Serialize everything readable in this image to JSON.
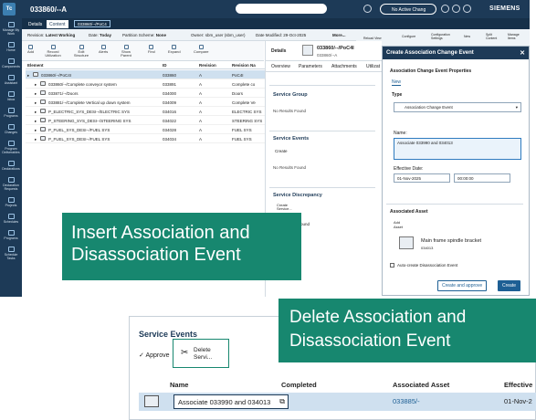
{
  "topbar": {
    "app_badge": "Tc",
    "object_title": "033860/--A",
    "search_placeholder": "",
    "change_context": "No Active Chang",
    "brand": "SIEMENS"
  },
  "sidebar": {
    "items": [
      {
        "label": "Manage My Work",
        "icon": "inbox-icon"
      },
      {
        "label": "Home",
        "icon": "home-icon"
      },
      {
        "label": "Components",
        "icon": "components-icon"
      },
      {
        "label": "Assistant",
        "icon": "assistant-icon"
      },
      {
        "label": "Inbox",
        "icon": "inbox-tray-icon"
      },
      {
        "label": "Programs",
        "icon": "programs-icon"
      },
      {
        "label": "Changes",
        "icon": "changes-icon"
      },
      {
        "label": "Program Deliverables",
        "icon": "deliverables-icon"
      },
      {
        "label": "Declarations",
        "icon": "declarations-icon"
      },
      {
        "label": "Declaration Requests",
        "icon": "requests-icon"
      },
      {
        "label": "Projects",
        "icon": "projects-icon"
      },
      {
        "label": "Schedules",
        "icon": "schedules-icon"
      },
      {
        "label": "Programs",
        "icon": "programs2-icon"
      },
      {
        "label": "Schedule Tasks",
        "icon": "tasks-icon"
      }
    ]
  },
  "tabs": {
    "details": "Details",
    "content": "Content",
    "crumb": "033860/--/PoC4"
  },
  "toolbar1": {
    "revision_rule_label": "Revision:",
    "revision_rule_value": "Latest Working",
    "date_label": "Date:",
    "date_value": "Today",
    "partition_label": "Partition Scheme:",
    "partition_value": "None",
    "owner_label": "Owner:",
    "owner_value": "sbm_user (sbm_user)",
    "date_modified_label": "Date Modified:",
    "date_modified_value": "29-Oct-2025",
    "more": "More..."
  },
  "toolbar1_right": {
    "items": [
      "Reload View",
      "Configure",
      "Configuration Settings",
      "New",
      "Split Content",
      "Manage Items"
    ]
  },
  "toolbar2": {
    "items": [
      "Add",
      "Record Utilization",
      "Edit Structure",
      "Alerts",
      "Show Parent",
      "Find",
      "Expand",
      "Compare"
    ]
  },
  "grid": {
    "headers": [
      "Element",
      "ID",
      "Revision",
      "Revision Na"
    ],
    "rows": [
      {
        "element": "033860/--/PoC4I",
        "id": "033860",
        "rev": "A",
        "revname": "PoC4I",
        "selected": true,
        "indent": 0
      },
      {
        "element": "033860/--/Complete conveyor system",
        "id": "033891",
        "rev": "A",
        "revname": "Complete co",
        "selected": false,
        "indent": 1
      },
      {
        "element": "033871/--/Doors",
        "id": "034000",
        "rev": "A",
        "revname": "Doors",
        "selected": false,
        "indent": 1
      },
      {
        "element": "033881/--/Complete Vertical up down system",
        "id": "034009",
        "rev": "A",
        "revname": "Complete Ve",
        "selected": false,
        "indent": 1
      },
      {
        "element": "P_ELECTRIC_SYS_DESI--/ELECTRIC SYS",
        "id": "034016",
        "rev": "A",
        "revname": "ELECTRIC SYS",
        "selected": false,
        "indent": 1
      },
      {
        "element": "P_STEERING_SYS_DESI--/STEERING SYS",
        "id": "034022",
        "rev": "A",
        "revname": "STEERING SYS",
        "selected": false,
        "indent": 1
      },
      {
        "element": "P_FUEL_SYS_DESI--/FUEL SYS",
        "id": "034028",
        "rev": "A",
        "revname": "FUEL SYS",
        "selected": false,
        "indent": 1
      },
      {
        "element": "P_FUEL_SYS_DESI--/FUEL SYS",
        "id": "034034",
        "rev": "A",
        "revname": "FUEL SYS",
        "selected": false,
        "indent": 1
      }
    ]
  },
  "mid": {
    "details_label": "Details",
    "title": "033860/--/PoC4I",
    "subtitle": "033860/--A",
    "tabs": [
      "Overview",
      "Parameters",
      "Attachments",
      "Utilizat"
    ],
    "service_group": "Service Group",
    "no_results_1": "No Results Found",
    "service_events": "Service Events",
    "create_label": "Create",
    "no_results_2": "No Results Found",
    "service_discrepancy": "Service Discrepancy",
    "create_service": "Create Service...",
    "partial_text": "ound"
  },
  "dialog": {
    "title": "Create Association Change Event",
    "props_section": "Association Change Event Properties",
    "new_tab": "New",
    "type_section": "Type",
    "type_value": "Association Change Event",
    "name_label": "Name:",
    "name_value": "Associate 033990 and 034013",
    "eff_date_label": "Effective Date:",
    "eff_date_value": "01-Nov-2025",
    "eff_time_value": "00:00:00",
    "asset_section": "Associated Asset",
    "add_label": "Add",
    "asset_label": "Asset",
    "asset_name": "Main frame spindle bracket",
    "asset_id": "034013",
    "auto_create_label": "Auto-create Disassociation Event",
    "btn_create_approve": "Create and approve",
    "btn_create": "Create"
  },
  "overlay1": {
    "line1": "Insert Association and",
    "line2": "Disassociation Event"
  },
  "overlay2": {
    "line1": "Delete Association and",
    "line2": "Disassociation Event"
  },
  "zoom": {
    "title": "Service Events",
    "approve": "Approve",
    "delete_line1": "Delete",
    "delete_line2": "Servi...",
    "headers": [
      "Name",
      "Completed",
      "Associated Asset",
      "Effective"
    ],
    "row": {
      "name": "Associate 033990 and 034013",
      "completed": "",
      "asset": "033885/-",
      "effective": "01-Nov-2"
    }
  }
}
